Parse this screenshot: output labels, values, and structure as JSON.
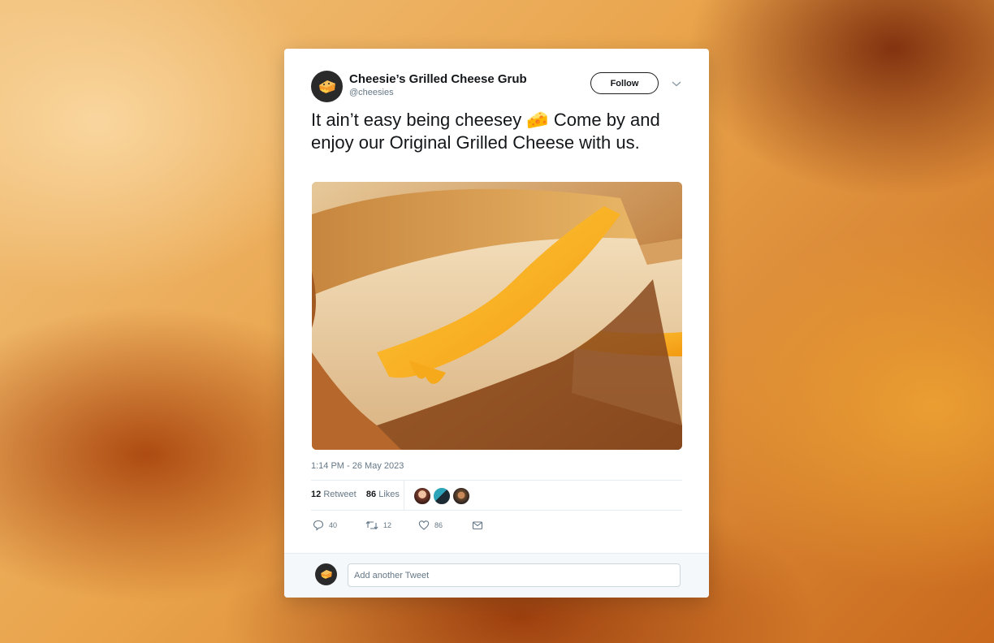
{
  "tweet": {
    "author_name": "Cheesie’s Grilled Cheese Grub",
    "author_handle": "@cheesies",
    "follow_label": "Follow",
    "text": "It ain’t easy being cheesey 🧀 Come by and enjoy our Original Grilled Cheese with us.",
    "timestamp": "1:14 PM - 26 May 2023",
    "image_subject": "grilled cheese sandwich"
  },
  "stats": {
    "retweets_count": "12",
    "retweets_label": "Retweet",
    "likes_count": "86",
    "likes_label": "Likes"
  },
  "actions": {
    "reply_count": "40",
    "retweet_count": "12",
    "like_count": "86"
  },
  "reply_box": {
    "placeholder": "Add another Tweet"
  },
  "colors": {
    "text_primary": "#14171a",
    "text_secondary": "#657786",
    "cheese_yellow": "#f5b21e"
  }
}
